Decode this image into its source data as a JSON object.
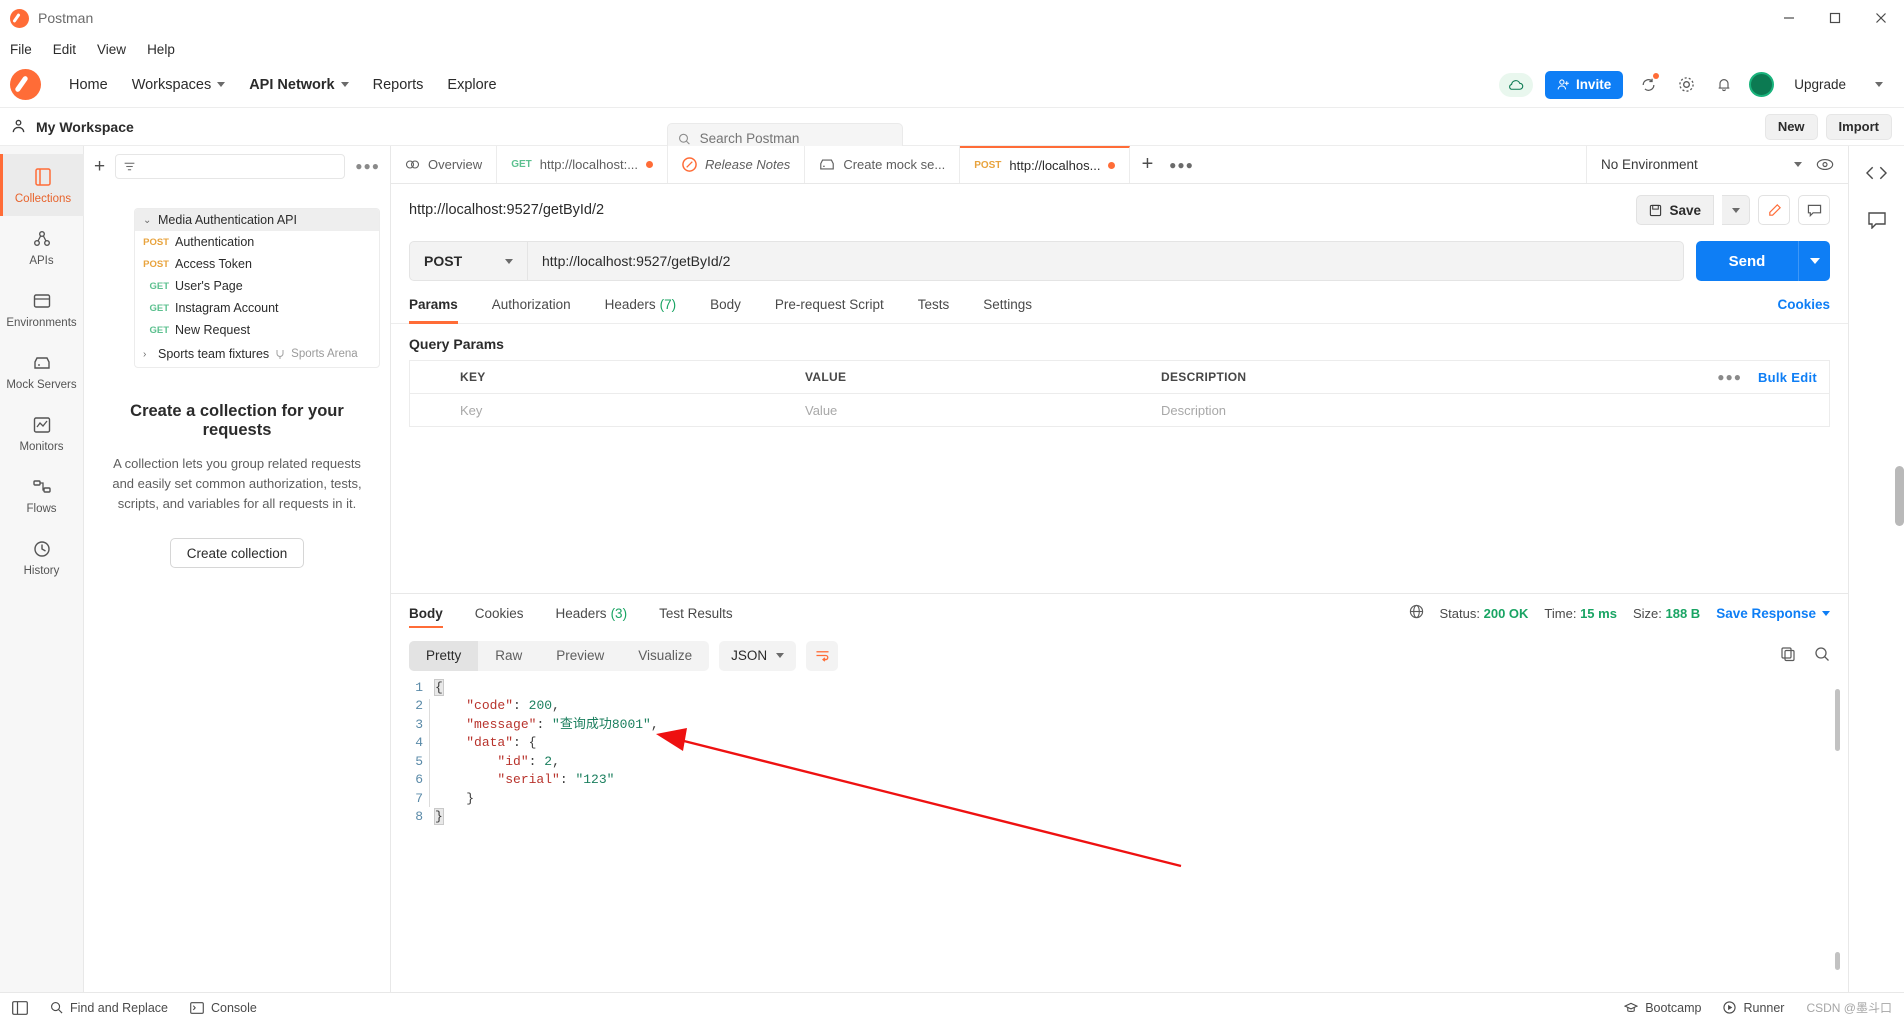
{
  "window": {
    "title": "Postman",
    "controls": [
      "minimize",
      "maximize",
      "close"
    ]
  },
  "menubar": [
    "File",
    "Edit",
    "View",
    "Help"
  ],
  "topnav": {
    "items": [
      "Home",
      "Workspaces",
      "API Network",
      "Reports",
      "Explore"
    ],
    "search_placeholder": "Search Postman",
    "invite_label": "Invite",
    "upgrade_label": "Upgrade"
  },
  "workspace": {
    "name": "My Workspace",
    "new_label": "New",
    "import_label": "Import"
  },
  "rail": [
    {
      "label": "Collections",
      "icon": "collections-icon",
      "active": true
    },
    {
      "label": "APIs",
      "icon": "apis-icon",
      "active": false
    },
    {
      "label": "Environments",
      "icon": "environments-icon",
      "active": false
    },
    {
      "label": "Mock Servers",
      "icon": "mock-servers-icon",
      "active": false
    },
    {
      "label": "Monitors",
      "icon": "monitors-icon",
      "active": false
    },
    {
      "label": "Flows",
      "icon": "flows-icon",
      "active": false
    },
    {
      "label": "History",
      "icon": "history-icon",
      "active": false
    }
  ],
  "sidebar": {
    "search_placeholder": "",
    "tree": [
      {
        "name": "Media Authentication API",
        "method": "",
        "type": "folder",
        "expanded": true
      },
      {
        "name": "Authentication",
        "method": "POST",
        "type": "request"
      },
      {
        "name": "Access Token",
        "method": "POST",
        "type": "request"
      },
      {
        "name": "User's Page",
        "method": "GET",
        "type": "request"
      },
      {
        "name": "Instagram Account",
        "method": "GET",
        "type": "request"
      },
      {
        "name": "New Request",
        "method": "GET",
        "type": "request"
      },
      {
        "name": "Sports team fixtures",
        "method": "",
        "type": "folder",
        "expanded": false,
        "sub": "Sports Arena"
      }
    ],
    "empty": {
      "heading": "Create a collection for your requests",
      "body": "A collection lets you group related requests and easily set common authorization, tests, scripts, and variables for all requests in it.",
      "button": "Create collection"
    }
  },
  "tabs": [
    {
      "label": "Overview",
      "method": "",
      "icon": "overview-icon",
      "active": false,
      "unsaved": false
    },
    {
      "label": "http://localhost:...",
      "method": "GET",
      "icon": "",
      "active": false,
      "unsaved": true
    },
    {
      "label": "Release Notes",
      "method": "",
      "icon": "postman-icon",
      "active": false,
      "unsaved": false
    },
    {
      "label": "Create mock se...",
      "method": "",
      "icon": "mock-icon",
      "active": false,
      "unsaved": false
    },
    {
      "label": "http://localhos...",
      "method": "POST",
      "icon": "",
      "active": true,
      "unsaved": true
    }
  ],
  "environment": {
    "selected": "No Environment"
  },
  "request": {
    "title": "http://localhost:9527/getById/2",
    "save_label": "Save",
    "method": "POST",
    "url": "http://localhost:9527/getById/2",
    "send_label": "Send",
    "tabs": [
      {
        "label": "Params",
        "count": "",
        "active": true
      },
      {
        "label": "Authorization",
        "count": "",
        "active": false
      },
      {
        "label": "Headers",
        "count": "(7)",
        "active": false
      },
      {
        "label": "Body",
        "count": "",
        "active": false
      },
      {
        "label": "Pre-request Script",
        "count": "",
        "active": false
      },
      {
        "label": "Tests",
        "count": "",
        "active": false
      },
      {
        "label": "Settings",
        "count": "",
        "active": false
      }
    ],
    "cookies_link": "Cookies",
    "query_params": {
      "title": "Query Params",
      "columns": [
        "KEY",
        "VALUE",
        "DESCRIPTION"
      ],
      "bulk_edit": "Bulk Edit",
      "placeholder_row": [
        "Key",
        "Value",
        "Description"
      ]
    }
  },
  "response": {
    "tabs": [
      {
        "label": "Body",
        "count": "",
        "active": true
      },
      {
        "label": "Cookies",
        "count": "",
        "active": false
      },
      {
        "label": "Headers",
        "count": "(3)",
        "active": false
      },
      {
        "label": "Test Results",
        "count": "",
        "active": false
      }
    ],
    "status_label": "Status:",
    "status_value": "200 OK",
    "time_label": "Time:",
    "time_value": "15 ms",
    "size_label": "Size:",
    "size_value": "188 B",
    "save_response": "Save Response",
    "view_modes": [
      "Pretty",
      "Raw",
      "Preview",
      "Visualize"
    ],
    "active_view": "Pretty",
    "format": "JSON",
    "body_lines": [
      {
        "n": "1",
        "indent": 0,
        "tokens": [
          {
            "t": "{",
            "c": "pun brace-hl"
          }
        ]
      },
      {
        "n": "2",
        "indent": 1,
        "tokens": [
          {
            "t": "\"code\"",
            "c": "k"
          },
          {
            "t": ": ",
            "c": "pun"
          },
          {
            "t": "200",
            "c": "num"
          },
          {
            "t": ",",
            "c": "pun"
          }
        ]
      },
      {
        "n": "3",
        "indent": 1,
        "tokens": [
          {
            "t": "\"message\"",
            "c": "k"
          },
          {
            "t": ": ",
            "c": "pun"
          },
          {
            "t": "\"查询成功8001\"",
            "c": "str"
          },
          {
            "t": ",",
            "c": "pun"
          }
        ]
      },
      {
        "n": "4",
        "indent": 1,
        "tokens": [
          {
            "t": "\"data\"",
            "c": "k"
          },
          {
            "t": ": ",
            "c": "pun"
          },
          {
            "t": "{",
            "c": "pun"
          }
        ]
      },
      {
        "n": "5",
        "indent": 2,
        "tokens": [
          {
            "t": "\"id\"",
            "c": "k"
          },
          {
            "t": ": ",
            "c": "pun"
          },
          {
            "t": "2",
            "c": "num"
          },
          {
            "t": ",",
            "c": "pun"
          }
        ]
      },
      {
        "n": "6",
        "indent": 2,
        "tokens": [
          {
            "t": "\"serial\"",
            "c": "k"
          },
          {
            "t": ": ",
            "c": "pun"
          },
          {
            "t": "\"123\"",
            "c": "str"
          }
        ]
      },
      {
        "n": "7",
        "indent": 1,
        "tokens": [
          {
            "t": "}",
            "c": "pun"
          }
        ]
      },
      {
        "n": "8",
        "indent": 0,
        "tokens": [
          {
            "t": "}",
            "c": "pun brace-hl"
          }
        ]
      }
    ]
  },
  "statusbar": {
    "find_replace": "Find and Replace",
    "console": "Console",
    "bootcamp": "Bootcamp",
    "runner": "Runner",
    "watermark": "CSDN @墨斗口"
  },
  "colors": {
    "accent": "#ff6c37",
    "blue": "#0e7ef5",
    "green": "#19a463",
    "post": "#e8a33d",
    "get": "#5cc08f"
  }
}
